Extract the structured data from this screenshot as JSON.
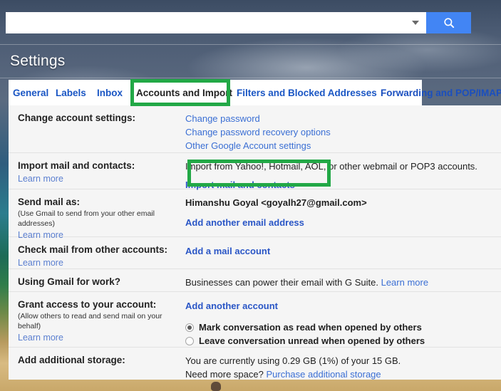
{
  "search": {
    "value": "",
    "placeholder": "",
    "options_icon": "chevron-down-icon",
    "search_icon": "search-icon"
  },
  "header": {
    "title": "Settings"
  },
  "tabs": [
    {
      "label": "General",
      "selected": false
    },
    {
      "label": "Labels",
      "selected": false
    },
    {
      "label": "Inbox",
      "selected": false
    },
    {
      "label": "Accounts and Import",
      "selected": true
    },
    {
      "label": "Filters and Blocked Addresses",
      "selected": false
    },
    {
      "label": "Forwarding and POP/IMAP",
      "selected": false
    }
  ],
  "settings": {
    "change_account": {
      "label": "Change account settings:",
      "links": [
        "Change password",
        "Change password recovery options",
        "Other Google Account settings"
      ]
    },
    "import_mail": {
      "label": "Import mail and contacts:",
      "learn_more": "Learn more",
      "description": "Import from Yahoo!, Hotmail, AOL, or other webmail or POP3 accounts.",
      "action": "Import mail and contacts"
    },
    "send_mail_as": {
      "label": "Send mail as:",
      "note": "(Use Gmail to send from your other email addresses)",
      "learn_more": "Learn more",
      "account": "Himanshu Goyal <goyalh27@gmail.com>",
      "action": "Add another email address"
    },
    "check_mail": {
      "label": "Check mail from other accounts:",
      "learn_more": "Learn more",
      "action": "Add a mail account"
    },
    "gmail_for_work": {
      "label": "Using Gmail for work?",
      "description": "Businesses can power their email with G Suite.",
      "link": "Learn more"
    },
    "grant_access": {
      "label": "Grant access to your account:",
      "note": "(Allow others to read and send mail on your behalf)",
      "learn_more": "Learn more",
      "action": "Add another account",
      "options": [
        {
          "label": "Mark conversation as read when opened by others",
          "selected": true
        },
        {
          "label": "Leave conversation unread when opened by others",
          "selected": false
        }
      ]
    },
    "storage": {
      "label": "Add additional storage:",
      "usage": "You are currently using 0.29 GB (1%) of your 15 GB.",
      "need_more": "Need more space?",
      "purchase_link": "Purchase additional storage"
    }
  },
  "annotations": {
    "highlight_color": "#22a846",
    "boxes": [
      "accounts-and-import-tab",
      "import-mail-and-contacts-link"
    ]
  },
  "colors": {
    "accent_blue": "#4285f4",
    "link_blue": "#3b6fd4",
    "panel_bg": "#f5f5f5"
  }
}
